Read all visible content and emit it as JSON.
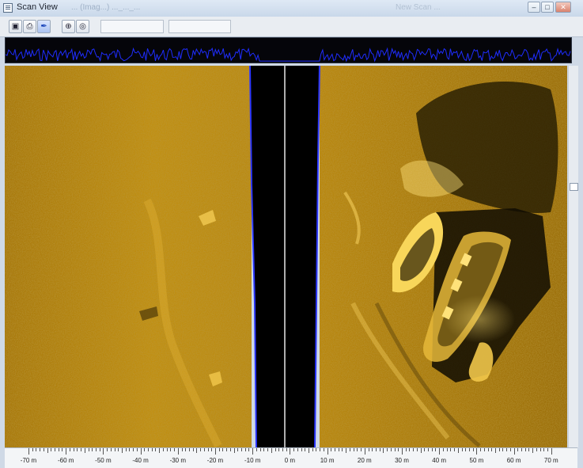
{
  "window": {
    "title": "Scan View",
    "ghost_title": "... (Imag...) ..._..._...",
    "ghost_title2": "New Scan ...",
    "buttons": {
      "minimize": "–",
      "maximize": "□",
      "close": "✕"
    }
  },
  "toolbar": {
    "icons": [
      "camera-icon",
      "print-icon",
      "pen-icon",
      "target-add-icon",
      "target-icon"
    ],
    "field1_value": "",
    "field2_value": ""
  },
  "colors": {
    "sonar_sand": "#b8860b",
    "sonar_highlight": "#ffd24a",
    "water_column": "#000000",
    "bottom_line": "#2b36ff",
    "signal_trace": "#1f2dff"
  },
  "range_axis": {
    "labels": [
      "-70 m",
      "-60 m",
      "-50 m",
      "-40 m",
      "-30 m",
      "-20 m",
      "-10 m",
      "0 m",
      "10 m",
      "20 m",
      "30 m",
      "40 m",
      "50 m",
      "60 m",
      "70 m"
    ]
  }
}
